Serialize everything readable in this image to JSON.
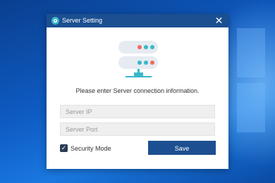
{
  "window": {
    "title": "Server Setting",
    "close_glyph": "✕",
    "icon": "app-logo-icon"
  },
  "illustration": {
    "icon": "server-network-icon"
  },
  "form": {
    "prompt": "Please enter Server connection information.",
    "server_ip": {
      "placeholder": "Server IP",
      "value": ""
    },
    "server_port": {
      "placeholder": "Server Port",
      "value": ""
    },
    "security_mode": {
      "label": "Security Mode",
      "checked": true,
      "check_glyph": "✓"
    },
    "save_label": "Save"
  },
  "colors": {
    "accent": "#1c4f91",
    "server_dot_red": "#ef6b5e",
    "server_dot_teal": "#38b8c9",
    "server_body": "#e6ebf2"
  }
}
